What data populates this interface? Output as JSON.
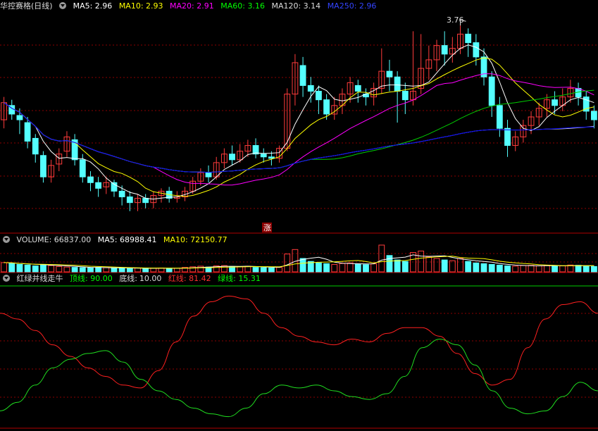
{
  "price_legend": {
    "title": "华控赛格(日线)",
    "ma5": "MA5: 2.96",
    "ma10": "MA10: 2.93",
    "ma20": "MA20: 2.91",
    "ma60": "MA60: 3.16",
    "ma120": "MA120: 3.14",
    "ma250": "MA250: 2.96",
    "high_annotation": "3.76",
    "up_marker": "涨"
  },
  "volume_legend": {
    "volume": "VOLUME: 66837.00",
    "ma5": "MA5: 68988.41",
    "ma10": "MA10: 72150.77"
  },
  "indicator_legend": {
    "name": "红绿并线走牛",
    "top": "顶线: 90.00",
    "bottom_label": "底线:",
    "bottom_value": "10.00",
    "red": "红线: 81.42",
    "green": "绿线: 15.31"
  },
  "colors": {
    "up": "#ff3b3b",
    "down": "#54ffff",
    "ma5": "#ffffff",
    "ma10": "#ffff00",
    "ma20": "#ff00ff",
    "ma60": "#00cc00",
    "ma120": "#d0d0d0",
    "ma250": "#0000ff",
    "red_line": "#ff2020",
    "green_line": "#20dd20",
    "grid": "#8b0000"
  },
  "chart_data": {
    "type": "candlestick",
    "price_range": [
      2.4,
      3.85
    ],
    "high_label_value": 3.76,
    "candles": [
      [
        3.1,
        3.22,
        3.26,
        3.04
      ],
      [
        3.2,
        3.14,
        3.24,
        3.1
      ],
      [
        3.13,
        3.1,
        3.18,
        3.0
      ],
      [
        3.08,
        2.95,
        3.12,
        2.9
      ],
      [
        2.97,
        2.86,
        3.0,
        2.8
      ],
      [
        2.85,
        2.7,
        2.88,
        2.66
      ],
      [
        2.7,
        2.78,
        2.82,
        2.66
      ],
      [
        2.79,
        2.86,
        2.9,
        2.74
      ],
      [
        2.88,
        2.98,
        3.02,
        2.84
      ],
      [
        2.96,
        2.82,
        3.0,
        2.78
      ],
      [
        2.82,
        2.7,
        2.86,
        2.66
      ],
      [
        2.7,
        2.66,
        2.74,
        2.6
      ],
      [
        2.66,
        2.62,
        2.7,
        2.56
      ],
      [
        2.63,
        2.66,
        2.7,
        2.58
      ],
      [
        2.66,
        2.6,
        2.68,
        2.56
      ],
      [
        2.6,
        2.56,
        2.64,
        2.5
      ],
      [
        2.56,
        2.52,
        2.6,
        2.46
      ],
      [
        2.52,
        2.55,
        2.58,
        2.46
      ],
      [
        2.55,
        2.52,
        2.58,
        2.48
      ],
      [
        2.52,
        2.57,
        2.6,
        2.48
      ],
      [
        2.57,
        2.6,
        2.62,
        2.52
      ],
      [
        2.6,
        2.55,
        2.63,
        2.52
      ],
      [
        2.55,
        2.56,
        2.6,
        2.52
      ],
      [
        2.56,
        2.6,
        2.63,
        2.53
      ],
      [
        2.6,
        2.67,
        2.7,
        2.58
      ],
      [
        2.67,
        2.73,
        2.76,
        2.64
      ],
      [
        2.73,
        2.7,
        2.78,
        2.66
      ],
      [
        2.7,
        2.8,
        2.84,
        2.68
      ],
      [
        2.8,
        2.86,
        2.9,
        2.76
      ],
      [
        2.86,
        2.82,
        2.92,
        2.78
      ],
      [
        2.82,
        2.88,
        2.93,
        2.8
      ],
      [
        2.88,
        2.92,
        2.96,
        2.84
      ],
      [
        2.92,
        2.86,
        2.97,
        2.83
      ],
      [
        2.86,
        2.84,
        2.9,
        2.8
      ],
      [
        2.84,
        2.83,
        2.88,
        2.78
      ],
      [
        2.83,
        2.9,
        2.92,
        2.8
      ],
      [
        2.9,
        3.28,
        3.32,
        2.88
      ],
      [
        3.28,
        3.5,
        3.56,
        3.2
      ],
      [
        3.48,
        3.34,
        3.54,
        3.26
      ],
      [
        3.34,
        3.3,
        3.4,
        3.22
      ],
      [
        3.3,
        3.24,
        3.34,
        3.14
      ],
      [
        3.24,
        3.14,
        3.28,
        3.1
      ],
      [
        3.14,
        3.2,
        3.26,
        3.1
      ],
      [
        3.2,
        3.28,
        3.32,
        3.14
      ],
      [
        3.28,
        3.36,
        3.4,
        3.22
      ],
      [
        3.34,
        3.3,
        3.38,
        3.22
      ],
      [
        3.28,
        3.26,
        3.32,
        3.2
      ],
      [
        3.26,
        3.32,
        3.36,
        3.2
      ],
      [
        3.32,
        3.44,
        3.6,
        3.28
      ],
      [
        3.44,
        3.4,
        3.52,
        3.3
      ],
      [
        3.4,
        3.3,
        3.44,
        3.08
      ],
      [
        3.3,
        3.24,
        3.36,
        3.14
      ],
      [
        3.24,
        3.3,
        3.72,
        3.2
      ],
      [
        3.32,
        3.46,
        3.7,
        3.28
      ],
      [
        3.46,
        3.52,
        3.62,
        3.38
      ],
      [
        3.52,
        3.62,
        3.66,
        3.44
      ],
      [
        3.62,
        3.56,
        3.72,
        3.48
      ],
      [
        3.56,
        3.6,
        3.68,
        3.5
      ],
      [
        3.6,
        3.7,
        3.76,
        3.56
      ],
      [
        3.7,
        3.64,
        3.74,
        3.54
      ],
      [
        3.64,
        3.54,
        3.7,
        3.48
      ],
      [
        3.54,
        3.4,
        3.6,
        3.34
      ],
      [
        3.4,
        3.2,
        3.44,
        3.12
      ],
      [
        3.2,
        3.04,
        3.26,
        2.98
      ],
      [
        3.04,
        2.92,
        3.1,
        2.84
      ],
      [
        2.92,
        2.98,
        3.02,
        2.88
      ],
      [
        2.98,
        3.06,
        3.1,
        2.94
      ],
      [
        3.06,
        3.12,
        3.16,
        3.0
      ],
      [
        3.12,
        3.18,
        3.22,
        3.06
      ],
      [
        3.18,
        3.24,
        3.28,
        3.12
      ],
      [
        3.24,
        3.2,
        3.3,
        3.14
      ],
      [
        3.2,
        3.26,
        3.32,
        3.16
      ],
      [
        3.26,
        3.32,
        3.38,
        3.22
      ],
      [
        3.32,
        3.26,
        3.36,
        3.2
      ],
      [
        3.26,
        3.16,
        3.3,
        3.1
      ],
      [
        3.16,
        3.1,
        3.2,
        3.04
      ]
    ],
    "volume": [
      62,
      58,
      50,
      46,
      40,
      48,
      42,
      36,
      32,
      30,
      28,
      26,
      30,
      28,
      26,
      24,
      22,
      26,
      22,
      24,
      26,
      22,
      24,
      30,
      34,
      38,
      32,
      40,
      42,
      36,
      34,
      38,
      30,
      28,
      26,
      30,
      120,
      150,
      90,
      70,
      60,
      55,
      50,
      56,
      60,
      52,
      48,
      54,
      180,
      110,
      80,
      70,
      130,
      140,
      100,
      90,
      80,
      75,
      90,
      70,
      60,
      55,
      50,
      45,
      40,
      38,
      42,
      44,
      40,
      42,
      38,
      40,
      46,
      44,
      40,
      36
    ],
    "red_line": [
      80,
      76,
      68,
      58,
      50,
      42,
      36,
      30,
      28,
      40,
      60,
      78,
      88,
      92,
      90,
      80,
      70,
      64,
      60,
      58,
      62,
      60,
      66,
      70,
      70,
      64,
      52,
      38,
      30,
      34,
      56,
      76,
      86,
      88,
      80
    ],
    "green_line": [
      12,
      18,
      30,
      42,
      48,
      52,
      54,
      46,
      34,
      26,
      20,
      14,
      10,
      8,
      14,
      24,
      30,
      28,
      30,
      26,
      22,
      20,
      24,
      36,
      56,
      62,
      58,
      44,
      26,
      14,
      10,
      12,
      22,
      32,
      26
    ]
  }
}
